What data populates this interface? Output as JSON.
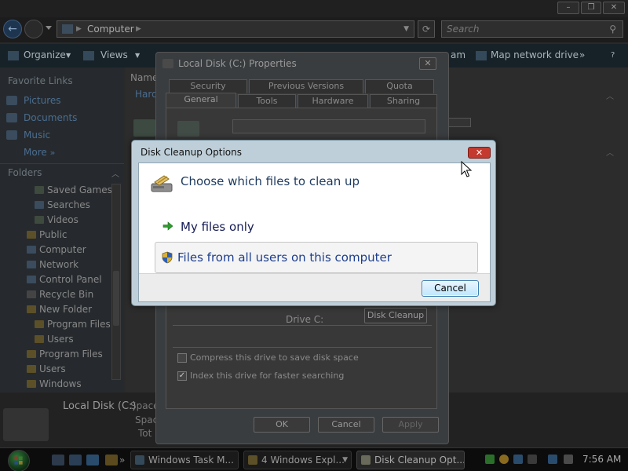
{
  "explorer": {
    "address": "Computer",
    "search_placeholder": "Search",
    "toolbar": {
      "organize": "Organize",
      "views": "Views",
      "map_drive": "Map network drive",
      "more": "»"
    },
    "favorite_links_header": "Favorite Links",
    "favorites": [
      "Pictures",
      "Documents",
      "Music",
      "More"
    ],
    "folders_header": "Folders",
    "folders": [
      "Saved Games",
      "Searches",
      "Videos",
      "Public",
      "Computer",
      "Network",
      "Control Panel",
      "Recycle Bin",
      "New Folder",
      "Program Files",
      "Users",
      "Program Files",
      "Users",
      "Windows"
    ],
    "content": {
      "name_col": "Name",
      "item_partial": "Hard"
    },
    "details": {
      "name": "Local Disk (C:)",
      "space_label": "Space",
      "total_label": "Tot"
    }
  },
  "properties": {
    "title": "Local Disk (C:) Properties",
    "tabs_row1": [
      "Security",
      "Previous Versions",
      "Quota"
    ],
    "tabs_row2": [
      "General",
      "Tools",
      "Hardware",
      "Sharing"
    ],
    "drive_label": "Drive C:",
    "disk_cleanup_button": "Disk Cleanup",
    "compress_label": "Compress this drive to save disk space",
    "index_label": "Index this drive for faster searching",
    "ok": "OK",
    "cancel": "Cancel",
    "apply": "Apply"
  },
  "cleanup_dialog": {
    "title": "Disk Cleanup Options",
    "instruction": "Choose which files to clean up",
    "option_my_files": "My files only",
    "option_all_users": "Files from all users on this computer",
    "cancel": "Cancel",
    "close_glyph": "✕"
  },
  "taskbar": {
    "tasks": [
      "Windows Task M...",
      "4 Windows Expl...",
      "Disk Cleanup Opt..."
    ],
    "clock": "7:56 AM"
  }
}
